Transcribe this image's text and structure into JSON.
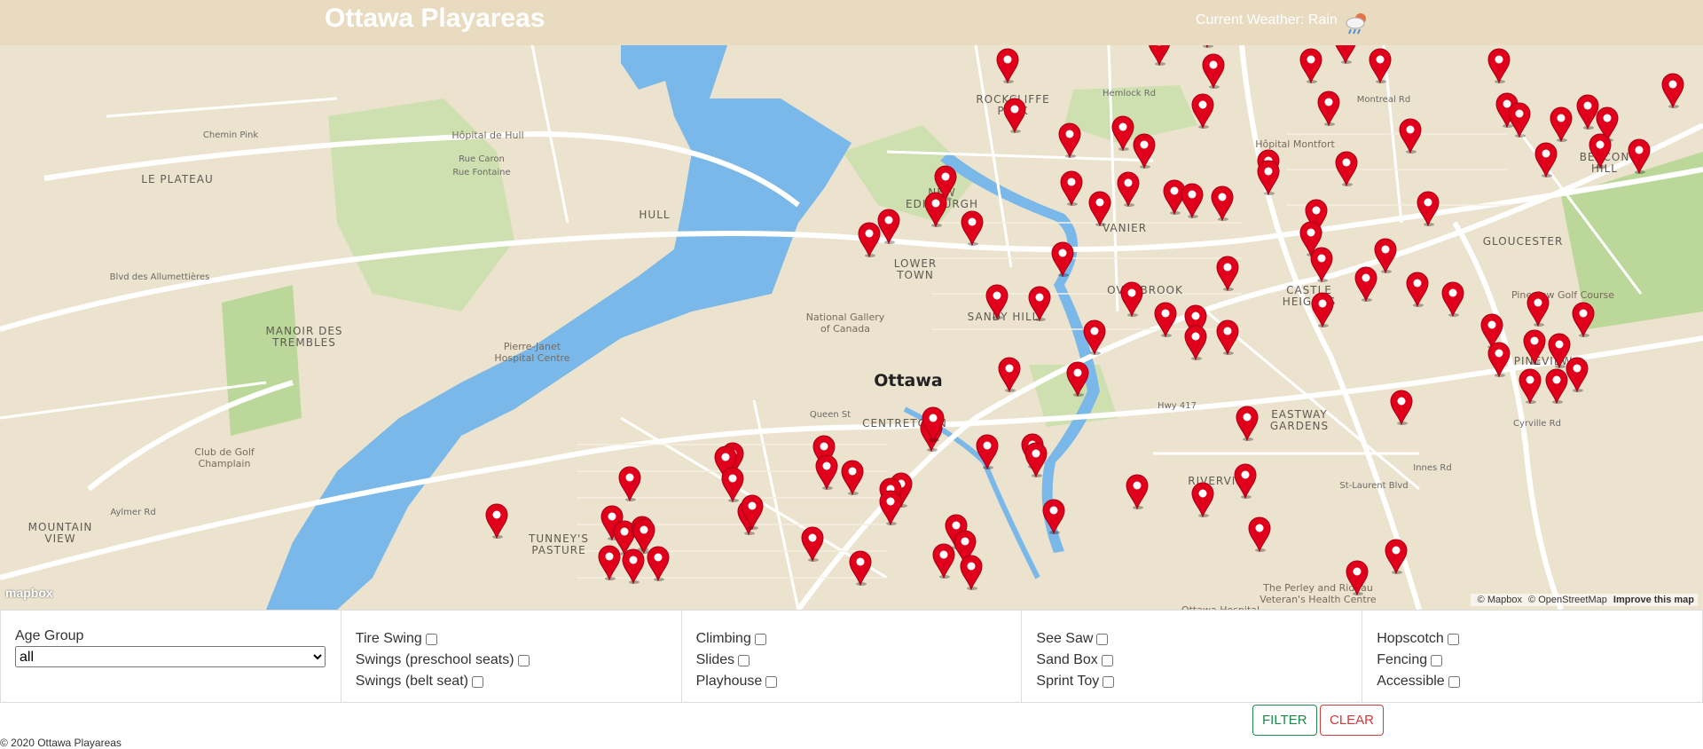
{
  "header": {
    "title": "Ottawa Playareas",
    "weather_text": "Current Weather: Rain",
    "weather_icon": "rain-cloud-icon"
  },
  "map": {
    "city_label": "Ottawa",
    "labels": [
      {
        "text": "Hôpital de Hull",
        "kind": "place"
      },
      {
        "text": "LE PLATEAU",
        "kind": "district"
      },
      {
        "text": "HULL",
        "kind": "district"
      },
      {
        "text": "MANOIR DES\nTREMBLES",
        "kind": "district"
      },
      {
        "text": "Pierre-Janet\nHospital Centre",
        "kind": "place"
      },
      {
        "text": "Club de Golf\nChamplain",
        "kind": "place"
      },
      {
        "text": "MOUNTAIN\nVIEW",
        "kind": "district"
      },
      {
        "text": "Blvd des Allumettières",
        "kind": "road"
      },
      {
        "text": "Chemin Pink",
        "kind": "road"
      },
      {
        "text": "Rue Caron",
        "kind": "road"
      },
      {
        "text": "Rue Fontaine",
        "kind": "road"
      },
      {
        "text": "Aylmer Rd",
        "kind": "road"
      },
      {
        "text": "National Gallery\nof Canada",
        "kind": "place"
      },
      {
        "text": "LOWER\nTOWN",
        "kind": "district"
      },
      {
        "text": "SANDY HILL",
        "kind": "district"
      },
      {
        "text": "CENTRETOWN",
        "kind": "district"
      },
      {
        "text": "TUNNEY'S\nPASTURE",
        "kind": "district"
      },
      {
        "text": "VANIER",
        "kind": "district"
      },
      {
        "text": "Hôpital Montfort",
        "kind": "place"
      },
      {
        "text": "CASTLE\nHEIGHTS",
        "kind": "district"
      },
      {
        "text": "GLOUCESTER",
        "kind": "district"
      },
      {
        "text": "Pineview Golf Course",
        "kind": "place"
      },
      {
        "text": "PINEVIEW",
        "kind": "district"
      },
      {
        "text": "EASTWAY\nGARDENS",
        "kind": "district"
      },
      {
        "text": "RIVERVIEW",
        "kind": "district"
      },
      {
        "text": "The Perley and Rideau\nVeteran's Health Centre",
        "kind": "place"
      },
      {
        "text": "Ottawa Hospital",
        "kind": "place"
      },
      {
        "text": "ROCKCLIFFE\nPARK",
        "kind": "district"
      },
      {
        "text": "OVERBROOK",
        "kind": "district"
      },
      {
        "text": "BEACON\nHILL",
        "kind": "district"
      },
      {
        "text": "NEW\nEDINBURGH",
        "kind": "district"
      },
      {
        "text": "Hwy 417",
        "kind": "road"
      },
      {
        "text": "Queen St",
        "kind": "road"
      },
      {
        "text": "Hemlock Rd",
        "kind": "road"
      },
      {
        "text": "Innes Rd",
        "kind": "road"
      },
      {
        "text": "St-Laurent Blvd",
        "kind": "road"
      },
      {
        "text": "Cyrville Rd",
        "kind": "road"
      },
      {
        "text": "Montreal Rd",
        "kind": "road"
      }
    ],
    "marker_icon": "map-pin-icon",
    "marker_color": "#e0001b",
    "logo_text": "mapbox",
    "attribution": [
      "© Mapbox",
      "© OpenStreetMap",
      "Improve this map"
    ]
  },
  "filters": {
    "age_group": {
      "label": "Age Group",
      "selected": "all"
    },
    "columns": [
      [
        "Tire Swing",
        "Swings (preschool seats)",
        "Swings (belt seat)"
      ],
      [
        "Climbing",
        "Slides",
        "Playhouse"
      ],
      [
        "See Saw",
        "Sand Box",
        "Sprint Toy"
      ],
      [
        "Hopscotch",
        "Fencing",
        "Accessible"
      ]
    ]
  },
  "buttons": {
    "filter": "FILTER",
    "clear": "CLEAR"
  },
  "footer": {
    "text": "© 2020 Ottawa Playareas"
  },
  "colors": {
    "header_bg": "#e8dbbf",
    "water": "#7ab8ea",
    "park": "#c6dea5",
    "land": "#ebe3cd"
  }
}
